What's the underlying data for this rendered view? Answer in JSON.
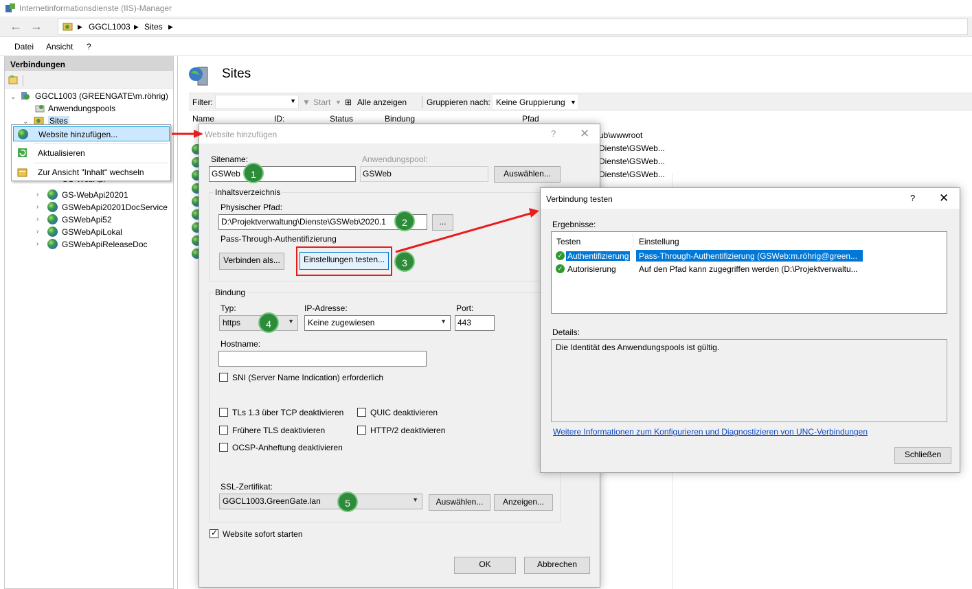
{
  "window": {
    "title": "Internetinformationsdienste (IIS)-Manager"
  },
  "address": {
    "segments": [
      "GGCL1003",
      "Sites"
    ]
  },
  "menu": {
    "items": [
      "Datei",
      "Ansicht",
      "?"
    ]
  },
  "connections": {
    "header": "Verbindungen",
    "server": "GGCL1003 (GREENGATE\\m.röhrig)",
    "app_pools": "Anwendungspools",
    "sites": "Sites",
    "site_partial": "GS-WebApi",
    "sites_list": [
      "GS-WebApi20201",
      "GSWebApi20201DocService",
      "GSWebApi52",
      "GSWebApiLokal",
      "GSWebApiReleaseDoc"
    ]
  },
  "context_menu": {
    "items": [
      "Website hinzufügen...",
      "Aktualisieren",
      "Zur Ansicht \"Inhalt\" wechseln"
    ]
  },
  "main": {
    "title": "Sites",
    "filter_label": "Filter:",
    "start_label": "Start",
    "show_all_label": "Alle anzeigen",
    "group_label": "Gruppieren nach:",
    "group_value": "Keine Gruppierung",
    "columns": [
      "Name",
      "ID:",
      "Status",
      "Bindung",
      "Pfad"
    ],
    "paths": [
      "ub\\wwwroot",
      "Dienste\\GSWeb...",
      "Dienste\\GSWeb...",
      "Dienste\\GSWeb..."
    ]
  },
  "add_site_dialog": {
    "title": "Website hinzufügen",
    "help": "?",
    "close": "✕",
    "sitename_label": "Sitename:",
    "sitename_value": "GSWeb",
    "app_pool_label": "Anwendungspool:",
    "app_pool_value": "GSWeb",
    "select_pool_button": "Auswählen...",
    "content_group": "Inhaltsverzeichnis",
    "physical_path_label": "Physischer Pfad:",
    "physical_path_value": "D:\\Projektverwaltung\\Dienste\\GSWeb\\2020.1",
    "browse_button": "...",
    "passthrough_label": "Pass-Through-Authentifizierung",
    "connect_as_button": "Verbinden als...",
    "test_settings_button": "Einstellungen testen...",
    "binding_group": "Bindung",
    "type_label": "Typ:",
    "type_value": "https",
    "ip_label": "IP-Adresse:",
    "ip_value": "Keine zugewiesen",
    "port_label": "Port:",
    "port_value": "443",
    "hostname_label": "Hostname:",
    "hostname_value": "",
    "sni_label": "SNI (Server Name Indication) erforderlich",
    "tls13_label": "TLs 1.3 über TCP deaktivieren",
    "quic_label": "QUIC deaktivieren",
    "old_tls_label": "Frühere TLS deaktivieren",
    "http2_label": "HTTP/2 deaktivieren",
    "ocsp_label": "OCSP-Anheftung deaktivieren",
    "ssl_label": "SSL-Zertifikat:",
    "ssl_value": "GGCL1003.GreenGate.lan",
    "ssl_select_button": "Auswählen...",
    "ssl_view_button": "Anzeigen...",
    "start_now_label": "Website sofort starten",
    "ok_button": "OK",
    "cancel_button": "Abbrechen"
  },
  "test_dialog": {
    "title": "Verbindung testen",
    "help": "?",
    "close": "✕",
    "results_label": "Ergebnisse:",
    "columns": [
      "Testen",
      "Einstellung"
    ],
    "rows": [
      {
        "test": "Authentifizierung",
        "setting": "Pass-Through-Authentifizierung (GSWeb:m.röhrig@green..."
      },
      {
        "test": "Autorisierung",
        "setting": "Auf den Pfad kann zugegriffen werden (D:\\Projektverwaltu..."
      }
    ],
    "details_label": "Details:",
    "details_text": "Die Identität des Anwendungspools ist gültig.",
    "link": "Weitere Informationen zum Konfigurieren und Diagnostizieren von UNC-Verbindungen",
    "close_button": "Schließen"
  },
  "badges": [
    "1",
    "2",
    "3",
    "4",
    "5"
  ],
  "colors": {
    "annotation_red": "#e81c1c",
    "badge_green": "#2e8b3a",
    "selection_blue": "#0078d7",
    "link_blue": "#0a47c4"
  }
}
